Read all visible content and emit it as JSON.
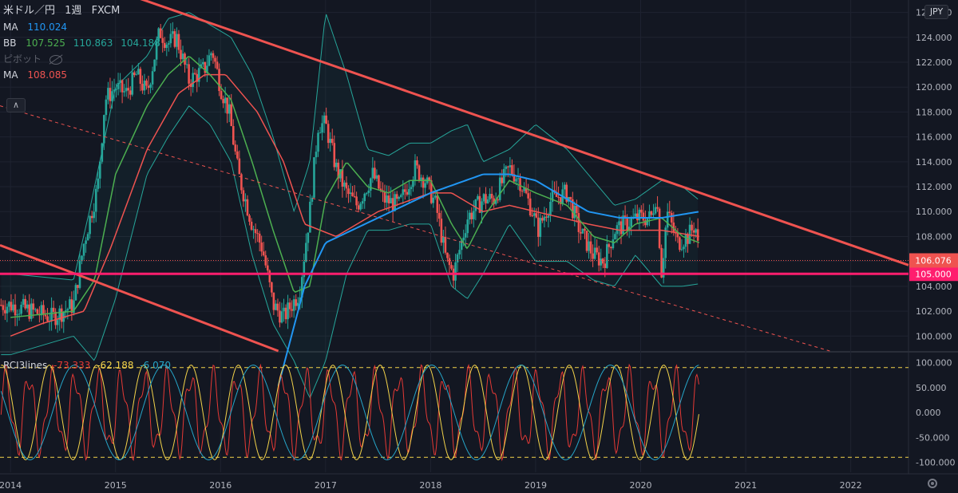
{
  "header": {
    "symbol": "米ドル／円",
    "interval": "1週",
    "source": "FXCM",
    "currency_badge": "JPY"
  },
  "indicators": {
    "ma1": {
      "label": "MA",
      "value": "110.024",
      "color": "#2196f3"
    },
    "bb": {
      "label": "BB",
      "mid": "107.525",
      "upper": "110.863",
      "lower": "104.188",
      "mid_color": "#4caf50",
      "band_color": "#26a69a"
    },
    "pivot": {
      "label": "ピボット"
    },
    "ma2": {
      "label": "MA",
      "value": "108.085",
      "color": "#ef5350"
    }
  },
  "price_panel": {
    "current_price": "106.076",
    "support_line_label": "105.000",
    "support_line_color": "#ff1e6e",
    "trendline_color": "#ef5350"
  },
  "rci": {
    "label": "RCI3lines",
    "short": "-73.333",
    "mid": "-62.188",
    "long": "-6.070",
    "short_color": "#e53935",
    "mid_color": "#f3d34a",
    "long_color": "#26a6c9"
  },
  "chart_data": [
    {
      "type": "candlestick",
      "title": "米ドル／円 1週 FXCM",
      "x_ticks": [
        "2014",
        "2015",
        "2016",
        "2017",
        "2018",
        "2019",
        "2020",
        "2021",
        "2022"
      ],
      "y_ticks": [
        "100.000",
        "102.000",
        "104.000",
        "106.000",
        "108.000",
        "110.000",
        "112.000",
        "114.000",
        "116.000",
        "118.000",
        "120.000",
        "122.000",
        "124.000",
        "126.000"
      ],
      "ylim": [
        98.8,
        127
      ],
      "xlim": [
        2013.9,
        2022.55
      ],
      "price_anchors": [
        [
          2014.0,
          102.5
        ],
        [
          2014.2,
          102.0
        ],
        [
          2014.4,
          101.5
        ],
        [
          2014.6,
          102.5
        ],
        [
          2014.7,
          107.5
        ],
        [
          2014.83,
          112.0
        ],
        [
          2014.9,
          119.0
        ],
        [
          2015.0,
          120.0
        ],
        [
          2015.1,
          119.5
        ],
        [
          2015.2,
          121.0
        ],
        [
          2015.3,
          119.5
        ],
        [
          2015.42,
          124.5
        ],
        [
          2015.5,
          123.5
        ],
        [
          2015.58,
          124.0
        ],
        [
          2015.7,
          120.5
        ],
        [
          2015.85,
          121.5
        ],
        [
          2015.92,
          123.0
        ],
        [
          2016.0,
          120.0
        ],
        [
          2016.08,
          118.0
        ],
        [
          2016.17,
          113.0
        ],
        [
          2016.3,
          109.0
        ],
        [
          2016.4,
          107.0
        ],
        [
          2016.5,
          102.5
        ],
        [
          2016.6,
          101.5
        ],
        [
          2016.75,
          103.5
        ],
        [
          2016.85,
          110.0
        ],
        [
          2016.93,
          117.0
        ],
        [
          2017.0,
          117.0
        ],
        [
          2017.1,
          113.5
        ],
        [
          2017.2,
          111.5
        ],
        [
          2017.3,
          110.5
        ],
        [
          2017.45,
          113.0
        ],
        [
          2017.55,
          111.0
        ],
        [
          2017.7,
          110.5
        ],
        [
          2017.85,
          113.5
        ],
        [
          2017.95,
          112.5
        ],
        [
          2018.05,
          110.5
        ],
        [
          2018.15,
          106.0
        ],
        [
          2018.22,
          105.0
        ],
        [
          2018.35,
          109.5
        ],
        [
          2018.5,
          111.0
        ],
        [
          2018.6,
          111.0
        ],
        [
          2018.75,
          113.5
        ],
        [
          2018.85,
          112.5
        ],
        [
          2018.97,
          110.0
        ],
        [
          2019.02,
          108.5
        ],
        [
          2019.15,
          111.0
        ],
        [
          2019.3,
          111.5
        ],
        [
          2019.42,
          108.5
        ],
        [
          2019.55,
          106.5
        ],
        [
          2019.65,
          106.0
        ],
        [
          2019.75,
          108.5
        ],
        [
          2019.85,
          109.0
        ],
        [
          2019.97,
          109.5
        ],
        [
          2020.1,
          109.5
        ],
        [
          2020.15,
          111.5
        ],
        [
          2020.2,
          105.0
        ],
        [
          2020.25,
          110.0
        ],
        [
          2020.35,
          107.5
        ],
        [
          2020.45,
          108.0
        ],
        [
          2020.52,
          109.0
        ],
        [
          2020.56,
          106.1
        ]
      ],
      "ma_blue_anchors": [
        [
          2016.55,
          96.0
        ],
        [
          2016.8,
          104.0
        ],
        [
          2017.0,
          107.5
        ],
        [
          2017.5,
          109.5
        ],
        [
          2018.0,
          111.5
        ],
        [
          2018.5,
          113.0
        ],
        [
          2018.75,
          113.0
        ],
        [
          2019.0,
          112.5
        ],
        [
          2019.5,
          110.0
        ],
        [
          2019.8,
          109.5
        ],
        [
          2020.2,
          109.5
        ],
        [
          2020.56,
          110.0
        ]
      ],
      "ma_red_anchors": [
        [
          2014.0,
          100.0
        ],
        [
          2014.3,
          101.0
        ],
        [
          2014.7,
          102.0
        ],
        [
          2014.95,
          107.0
        ],
        [
          2015.3,
          115.0
        ],
        [
          2015.6,
          119.5
        ],
        [
          2015.85,
          121.0
        ],
        [
          2016.05,
          121.0
        ],
        [
          2016.35,
          118.0
        ],
        [
          2016.6,
          114.0
        ],
        [
          2016.8,
          109.0
        ],
        [
          2016.95,
          108.5
        ],
        [
          2017.1,
          108.0
        ],
        [
          2017.5,
          110.0
        ],
        [
          2018.0,
          111.5
        ],
        [
          2018.2,
          111.5
        ],
        [
          2018.5,
          110.0
        ],
        [
          2018.75,
          110.5
        ],
        [
          2019.0,
          110.0
        ],
        [
          2019.5,
          109.0
        ],
        [
          2019.8,
          108.5
        ],
        [
          2020.2,
          108.5
        ],
        [
          2020.56,
          108.0
        ]
      ],
      "bb_mid_anchors": [
        [
          2014.0,
          101.5
        ],
        [
          2014.6,
          102.0
        ],
        [
          2014.8,
          104.5
        ],
        [
          2015.0,
          113.0
        ],
        [
          2015.3,
          118.5
        ],
        [
          2015.5,
          121.0
        ],
        [
          2015.7,
          122.5
        ],
        [
          2015.9,
          121.0
        ],
        [
          2016.1,
          119.0
        ],
        [
          2016.3,
          114.0
        ],
        [
          2016.5,
          108.5
        ],
        [
          2016.7,
          103.5
        ],
        [
          2016.85,
          104.0
        ],
        [
          2017.0,
          111.0
        ],
        [
          2017.2,
          114.0
        ],
        [
          2017.4,
          112.0
        ],
        [
          2017.6,
          111.5
        ],
        [
          2017.8,
          112.5
        ],
        [
          2018.0,
          112.5
        ],
        [
          2018.2,
          109.0
        ],
        [
          2018.35,
          107.0
        ],
        [
          2018.5,
          109.5
        ],
        [
          2018.75,
          112.5
        ],
        [
          2019.0,
          111.5
        ],
        [
          2019.3,
          110.5
        ],
        [
          2019.55,
          108.0
        ],
        [
          2019.75,
          107.5
        ],
        [
          2019.95,
          109.0
        ],
        [
          2020.2,
          109.5
        ],
        [
          2020.4,
          108.0
        ],
        [
          2020.56,
          107.5
        ]
      ],
      "bb_upper_anchors": [
        [
          2014.0,
          105.0
        ],
        [
          2014.6,
          104.5
        ],
        [
          2014.75,
          110.0
        ],
        [
          2015.0,
          120.0
        ],
        [
          2015.3,
          122.5
        ],
        [
          2015.5,
          125.5
        ],
        [
          2015.7,
          126.0
        ],
        [
          2015.9,
          125.0
        ],
        [
          2016.1,
          124.0
        ],
        [
          2016.3,
          121.0
        ],
        [
          2016.5,
          116.0
        ],
        [
          2016.7,
          110.0
        ],
        [
          2016.85,
          114.0
        ],
        [
          2017.0,
          126.0
        ],
        [
          2017.2,
          121.0
        ],
        [
          2017.4,
          115.0
        ],
        [
          2017.6,
          114.5
        ],
        [
          2017.8,
          115.5
        ],
        [
          2018.0,
          115.5
        ],
        [
          2018.2,
          116.5
        ],
        [
          2018.35,
          117.0
        ],
        [
          2018.5,
          114.0
        ],
        [
          2018.75,
          115.0
        ],
        [
          2019.0,
          117.0
        ],
        [
          2019.3,
          115.0
        ],
        [
          2019.55,
          112.5
        ],
        [
          2019.75,
          110.5
        ],
        [
          2019.95,
          111.0
        ],
        [
          2020.2,
          112.5
        ],
        [
          2020.4,
          112.0
        ],
        [
          2020.56,
          110.9
        ]
      ],
      "bb_lower_anchors": [
        [
          2014.0,
          98.5
        ],
        [
          2014.6,
          100.0
        ],
        [
          2014.8,
          98.0
        ],
        [
          2015.0,
          103.0
        ],
        [
          2015.3,
          113.0
        ],
        [
          2015.5,
          116.0
        ],
        [
          2015.7,
          118.5
        ],
        [
          2015.9,
          117.0
        ],
        [
          2016.1,
          114.0
        ],
        [
          2016.3,
          106.5
        ],
        [
          2016.5,
          101.0
        ],
        [
          2016.7,
          98.0
        ],
        [
          2016.85,
          95.0
        ],
        [
          2017.0,
          98.0
        ],
        [
          2017.2,
          105.0
        ],
        [
          2017.4,
          108.5
        ],
        [
          2017.6,
          108.5
        ],
        [
          2017.8,
          109.0
        ],
        [
          2018.0,
          109.0
        ],
        [
          2018.2,
          104.0
        ],
        [
          2018.35,
          103.0
        ],
        [
          2018.5,
          105.0
        ],
        [
          2018.75,
          109.0
        ],
        [
          2019.0,
          106.0
        ],
        [
          2019.3,
          106.0
        ],
        [
          2019.55,
          104.5
        ],
        [
          2019.75,
          104.0
        ],
        [
          2019.95,
          106.5
        ],
        [
          2020.2,
          104.0
        ],
        [
          2020.4,
          104.0
        ],
        [
          2020.56,
          104.2
        ]
      ],
      "trendlines": [
        {
          "from": [
            2015.2,
            127.2
          ],
          "to": [
            2022.55,
            105.7
          ],
          "style": "solid"
        },
        {
          "from": [
            2013.9,
            107.3
          ],
          "to": [
            2016.55,
            98.8
          ],
          "style": "solid"
        },
        {
          "from": [
            2013.9,
            118.5
          ],
          "to": [
            2021.8,
            98.8
          ],
          "style": "dashed"
        }
      ],
      "horizontal_line": 105.0,
      "current_price": 106.076
    },
    {
      "type": "line",
      "title": "RCI3lines",
      "y_ticks": [
        "100.000",
        "50.000",
        "0.000",
        "-50.000",
        "-100.000"
      ],
      "ylim": [
        -120,
        120
      ],
      "bands": [
        90,
        -90
      ],
      "series": [
        {
          "name": "short",
          "color": "#e53935",
          "period": 0.22
        },
        {
          "name": "mid",
          "color": "#f3d34a",
          "period": 0.45
        },
        {
          "name": "long",
          "color": "#26a6c9",
          "period": 0.85
        }
      ]
    }
  ]
}
